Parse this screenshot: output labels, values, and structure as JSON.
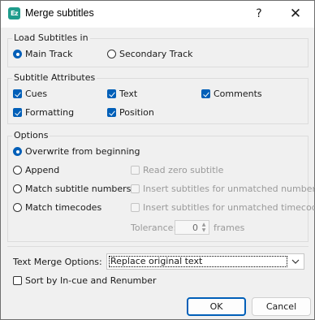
{
  "window": {
    "title": "Merge subtitles",
    "app_icon_text": "Ez",
    "help_glyph": "?",
    "close_glyph": "✕"
  },
  "load_group": {
    "legend": "Load Subtitles in",
    "main_track": "Main Track",
    "secondary_track": "Secondary Track",
    "selected": "main_track"
  },
  "attributes_group": {
    "legend": "Subtitle Attributes",
    "cues": "Cues",
    "text": "Text",
    "comments": "Comments",
    "formatting": "Formatting",
    "position": "Position",
    "checked": [
      "cues",
      "text",
      "comments",
      "formatting",
      "position"
    ]
  },
  "options_group": {
    "legend": "Options",
    "overwrite": "Overwrite from beginning",
    "append": "Append",
    "match_numbers": "Match subtitle numbers",
    "match_timecodes": "Match timecodes",
    "read_zero": "Read zero subtitle",
    "insert_unmatched_numbers": "Insert subtitles for unmatched numbers",
    "insert_unmatched_timecodes": "Insert subtitles for unmatched timecodes",
    "tolerance_label": "Tolerance:",
    "tolerance_value": "0",
    "tolerance_unit": "frames",
    "selected": "overwrite"
  },
  "merge": {
    "label": "Text Merge Options:",
    "selected_value": "Replace original text",
    "sort_label": "Sort by In-cue and Renumber",
    "sort_checked": false
  },
  "buttons": {
    "ok": "OK",
    "cancel": "Cancel"
  },
  "colors": {
    "accent": "#005fb8",
    "app_icon": "#1f9c8c"
  }
}
